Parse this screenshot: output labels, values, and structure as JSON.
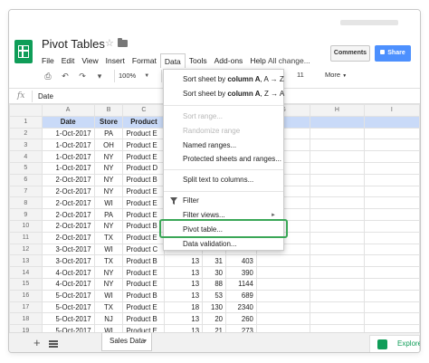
{
  "doc": {
    "title": "Pivot Tables"
  },
  "menus": [
    "File",
    "Edit",
    "View",
    "Insert",
    "Format",
    "Data",
    "Tools",
    "Add-ons",
    "Help"
  ],
  "last_edit": "All change...",
  "buttons": {
    "comments": "Comments",
    "share": "Share"
  },
  "toolbar": {
    "zoom": "100%",
    "currency": "$",
    "percent": "%",
    "font_size": "11",
    "more": "More"
  },
  "formula": {
    "fx": "fx",
    "value": "Date"
  },
  "columns": [
    "A",
    "B",
    "C",
    "",
    "",
    "",
    "G",
    "H",
    "I"
  ],
  "rows": [
    {
      "n": "1",
      "date": "Date",
      "store": "Store",
      "product": "Product",
      "d": "",
      "e": "",
      "f": ""
    },
    {
      "n": "2",
      "date": "1-Oct-2017",
      "store": "PA",
      "product": "Product E",
      "d": "",
      "e": "",
      "f": ""
    },
    {
      "n": "3",
      "date": "1-Oct-2017",
      "store": "OH",
      "product": "Product E",
      "d": "",
      "e": "",
      "f": ""
    },
    {
      "n": "4",
      "date": "1-Oct-2017",
      "store": "NY",
      "product": "Product E",
      "d": "",
      "e": "",
      "f": ""
    },
    {
      "n": "5",
      "date": "1-Oct-2017",
      "store": "NY",
      "product": "Product D",
      "d": "",
      "e": "",
      "f": ""
    },
    {
      "n": "6",
      "date": "2-Oct-2017",
      "store": "NY",
      "product": "Product B",
      "d": "",
      "e": "",
      "f": ""
    },
    {
      "n": "7",
      "date": "2-Oct-2017",
      "store": "NY",
      "product": "Product E",
      "d": "",
      "e": "",
      "f": ""
    },
    {
      "n": "8",
      "date": "2-Oct-2017",
      "store": "WI",
      "product": "Product E",
      "d": "",
      "e": "",
      "f": ""
    },
    {
      "n": "9",
      "date": "2-Oct-2017",
      "store": "PA",
      "product": "Product E",
      "d": "",
      "e": "",
      "f": ""
    },
    {
      "n": "10",
      "date": "2-Oct-2017",
      "store": "NY",
      "product": "Product B",
      "d": "",
      "e": "",
      "f": ""
    },
    {
      "n": "11",
      "date": "2-Oct-2017",
      "store": "TX",
      "product": "Product E",
      "d": "",
      "e": "",
      "f": ""
    },
    {
      "n": "12",
      "date": "3-Oct-2017",
      "store": "WI",
      "product": "Product C",
      "d": "",
      "e": "",
      "f": ""
    },
    {
      "n": "13",
      "date": "3-Oct-2017",
      "store": "TX",
      "product": "Product B",
      "d": "13",
      "e": "31",
      "f": "403"
    },
    {
      "n": "14",
      "date": "4-Oct-2017",
      "store": "NY",
      "product": "Product E",
      "d": "13",
      "e": "30",
      "f": "390"
    },
    {
      "n": "15",
      "date": "4-Oct-2017",
      "store": "NY",
      "product": "Product E",
      "d": "13",
      "e": "88",
      "f": "1144"
    },
    {
      "n": "16",
      "date": "5-Oct-2017",
      "store": "WI",
      "product": "Product B",
      "d": "13",
      "e": "53",
      "f": "689"
    },
    {
      "n": "17",
      "date": "5-Oct-2017",
      "store": "TX",
      "product": "Product E",
      "d": "18",
      "e": "130",
      "f": "2340"
    },
    {
      "n": "18",
      "date": "5-Oct-2017",
      "store": "NJ",
      "product": "Product B",
      "d": "13",
      "e": "20",
      "f": "260"
    },
    {
      "n": "19",
      "date": "5-Oct-2017",
      "store": "WI",
      "product": "Product E",
      "d": "13",
      "e": "21",
      "f": "273"
    },
    {
      "n": "20",
      "date": "",
      "store": "",
      "product": "",
      "d": "",
      "e": "",
      "f": ""
    }
  ],
  "data_menu": {
    "sort_az_prefix": "Sort sheet by ",
    "sort_az_bold": "column A",
    "sort_az_suffix": ", A → Z",
    "sort_za_prefix": "Sort sheet by ",
    "sort_za_bold": "column A",
    "sort_za_suffix": ", Z → A",
    "sort_range": "Sort range...",
    "randomize_range": "Randomize range",
    "named_ranges": "Named ranges...",
    "protected": "Protected sheets and ranges...",
    "split_text": "Split text to columns...",
    "filter": "Filter",
    "filter_views": "Filter views...",
    "pivot_table": "Pivot table...",
    "data_validation": "Data validation..."
  },
  "sheet_tab": "Sales Data",
  "explore": "Explore",
  "colors": {
    "brand_green": "#0f9d58",
    "share_blue": "#4d90fe",
    "header_blue": "#c9daf8",
    "highlight_green": "#3aa757"
  }
}
